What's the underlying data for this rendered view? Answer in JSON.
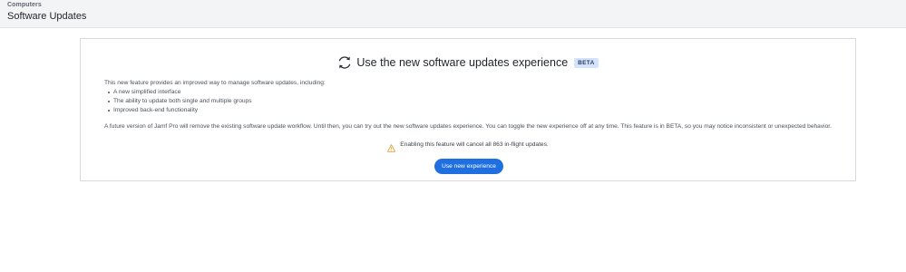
{
  "header": {
    "breadcrumb": "Computers",
    "title": "Software Updates"
  },
  "card": {
    "title": "Use the new software updates experience",
    "badge": "BETA",
    "intro": "This new feature provides an improved way to manage software updates, including:",
    "features": [
      "A new simplified interface",
      "The ability to update both single and multiple groups",
      "Improved back-end functionality"
    ],
    "notice": "A future version of Jamf Pro will remove the existing software update workflow. Until then, you can try out the new software updates experience. You can toggle the new experience off at any time. This feature is in BETA, so you may notice inconsistent or unexpected behavior.",
    "warning": "Enabling this feature will cancel all 863 in-flight updates.",
    "button_label": "Use new experience"
  },
  "icons": {
    "title_icon": "sync-icon",
    "warning_icon": "warning-icon"
  },
  "colors": {
    "accent": "#1f6fe0",
    "badge_bg": "#d3e3fb",
    "warning": "#e8a13a"
  }
}
